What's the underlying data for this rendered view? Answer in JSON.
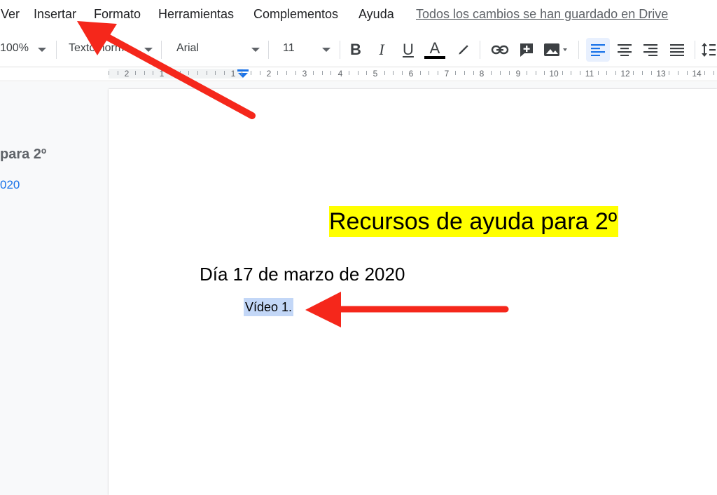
{
  "menu": {
    "items": [
      {
        "label": "Ver"
      },
      {
        "label": "Insertar"
      },
      {
        "label": "Formato"
      },
      {
        "label": "Herramientas"
      },
      {
        "label": "Complementos"
      },
      {
        "label": "Ayuda"
      }
    ],
    "save_status": "Todos los cambios se han guardado en Drive"
  },
  "toolbar": {
    "zoom": "100%",
    "style": "Texto normal",
    "font": "Arial",
    "size": "11",
    "bold": "B",
    "italic": "I",
    "underline": "U",
    "text_color_letter": "A",
    "text_color": "#000000",
    "accent_color": "#1a73e8"
  },
  "ruler": {
    "labels": [
      "2",
      "1",
      "1",
      "2",
      "3",
      "4",
      "5",
      "6",
      "7",
      "8",
      "9",
      "10",
      "11",
      "12",
      "13",
      "14"
    ]
  },
  "outline": {
    "heading": "para 2º",
    "link": "020"
  },
  "document": {
    "title": "Recursos de ayuda para 2º",
    "date_heading": "Día 17 de marzo de 2020",
    "selected_text": "Vídeo 1."
  },
  "colors": {
    "highlight": "#ffff00",
    "selection": "#c3d7f7",
    "annotation_arrow": "#f5271b"
  }
}
